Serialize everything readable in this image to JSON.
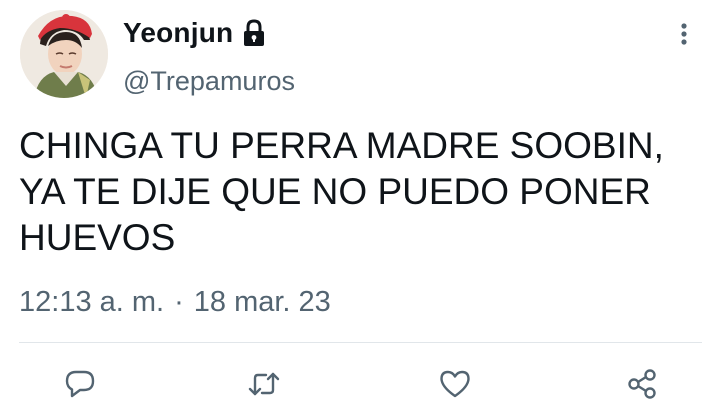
{
  "user": {
    "display_name": "Yeonjun",
    "handle": "@Trepamuros"
  },
  "tweet": {
    "text": "CHINGA TU PERRA MADRE SOOBIN,\nYA TE DIJE QUE NO PUEDO PONER\nHUEVOS",
    "time": "12:13 a. m.",
    "separator": "·",
    "date": "18 mar. 23"
  },
  "icons": {
    "lock": "lock-icon",
    "more": "more-vertical-icon",
    "reply": "reply-icon",
    "retweet": "retweet-icon",
    "like": "like-icon",
    "share": "share-icon"
  },
  "colors": {
    "text": "#0f1419",
    "secondary": "#536471",
    "icon": "#536471",
    "divider": "#e1e6ea"
  }
}
